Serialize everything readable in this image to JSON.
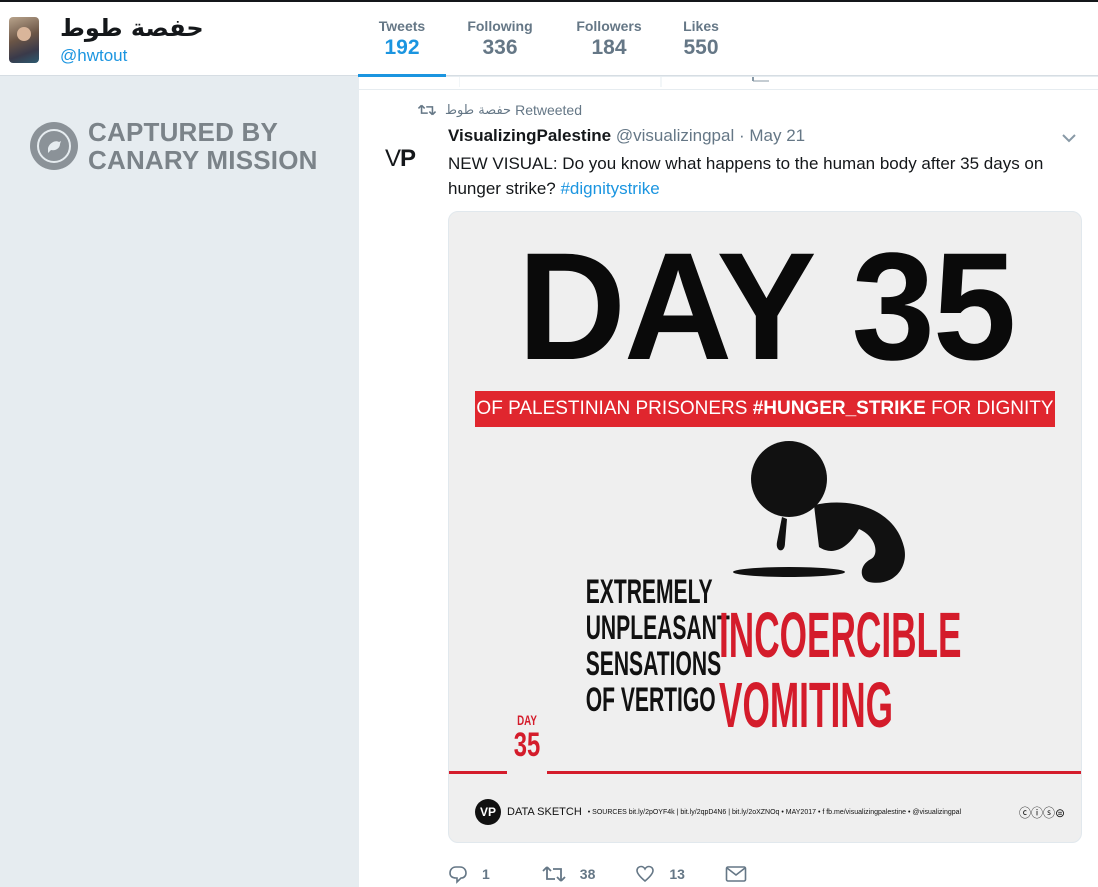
{
  "profile": {
    "name": "حفصة طوط",
    "handle": "@hwtout"
  },
  "stats": [
    {
      "label": "Tweets",
      "value": "192",
      "active": true
    },
    {
      "label": "Following",
      "value": "336"
    },
    {
      "label": "Followers",
      "value": "184"
    },
    {
      "label": "Likes",
      "value": "550"
    }
  ],
  "sidebar": {
    "watermark_line1": "CAPTURED BY",
    "watermark_line2": "CANARY MISSION",
    "watermark_icon": "canary-bird-icon"
  },
  "tweet": {
    "retweeted_by": "حفصة طوط",
    "retweeted_label": "Retweeted",
    "author_name": "VisualizingPalestine",
    "author_handle": "@visualizingpal",
    "separator": "·",
    "date": "May 21",
    "avatar_text_light": "V",
    "avatar_text_bold": "P",
    "text": "NEW VISUAL: Do you know what happens to the human body after 35 days on hunger strike?",
    "hashtag": "#dignitystrike",
    "media": {
      "title": "DAY 35",
      "banner_pre": "OF PALESTINIAN PRISONERS",
      "banner_tag": "#HUNGER_STRIKE",
      "banner_post": "FOR DIGNITY",
      "symptom_left": [
        "EXTREMELY",
        "UNPLEASANT",
        "SENSATIONS",
        "OF VERTIGO"
      ],
      "symptom_right": [
        "INCOERCIBLE",
        "VOMITING"
      ],
      "badge_day": "DAY",
      "badge_num": "35",
      "footer_logo": "VP",
      "footer_label": "DATA SKETCH",
      "footer_sources": "• SOURCES bit.ly/2pOYF4k | bit.ly/2qpD4N6 | bit.ly/2oXZNOq • MAY2017 • f fb.me/visualizingpalestine • @visualizingpal",
      "footer_license": "ⓒⓘⓢ⊜"
    },
    "actions": {
      "reply_count": "1",
      "retweet_count": "38",
      "like_count": "13"
    }
  },
  "colors": {
    "accent": "#1b95e0",
    "poster_red": "#d41c2b",
    "muted": "#657786"
  }
}
